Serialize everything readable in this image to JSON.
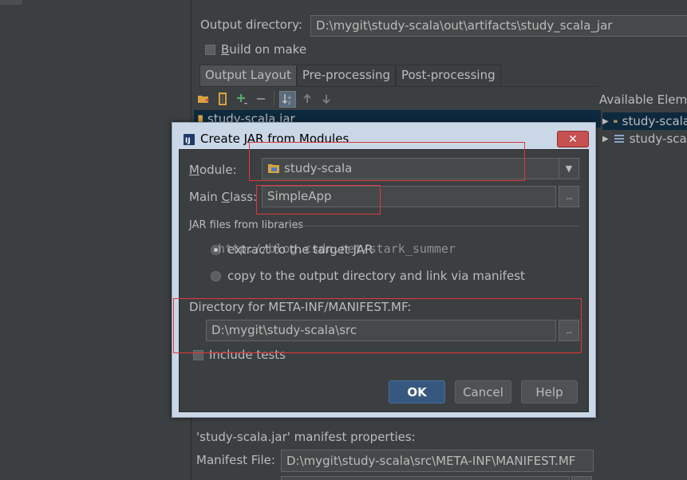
{
  "artifact_settings": {
    "output_directory_label": "Output directory:",
    "output_directory_value": "D:\\mygit\\study-scala\\out\\artifacts\\study_scala_jar",
    "build_on_make_label": "Build on make",
    "tabs": [
      {
        "label": "Output Layout",
        "active": true
      },
      {
        "label": "Pre-processing",
        "active": false
      },
      {
        "label": "Post-processing",
        "active": false
      }
    ],
    "layout_root_item": "study-scala.jar",
    "available_elements_header": "Available Elements",
    "available_elements": [
      "study-scala",
      "study-scala"
    ],
    "manifest_heading": "'study-scala.jar' manifest properties:",
    "manifest_file_label": "Manifest File:",
    "manifest_file_value": "D:\\mygit\\study-scala\\src\\META-INF\\MANIFEST.MF"
  },
  "dialog": {
    "title": "Create JAR from Modules",
    "close_glyph": "✕",
    "module_label": "Module:",
    "module_value": "study-scala",
    "main_class_label": "Main Class:",
    "main_class_value": "SimpleApp",
    "browse_glyph": "...",
    "jar_files_section_label": "JAR files from libraries",
    "radio_extract_label": "extract to the target JAR",
    "radio_copy_label": "copy to the output directory and link via manifest",
    "selected_radio": "extract",
    "manifest_dir_label": "Directory for META-INF/MANIFEST.MF:",
    "manifest_dir_value": "D:\\mygit\\study-scala\\src",
    "include_tests_label": "Include tests",
    "include_tests_checked": false,
    "ok_label": "OK",
    "cancel_label": "Cancel",
    "help_label": "Help"
  },
  "watermark_text": "http://blog.csdn.net/stark_summer",
  "colors": {
    "ide_background": "#3c3f41",
    "field_background": "#45494a",
    "dialog_frame": "#cad7e6",
    "selection": "#0d293e",
    "ok_button": "#365880",
    "annotation_red": "#e0383b",
    "close_button": "#c75050"
  },
  "icons": {
    "toolbar": [
      "new-folder-icon",
      "archive-icon",
      "add-icon",
      "remove-icon",
      "sort-icon",
      "move-up-icon",
      "move-down-icon"
    ],
    "dialog_title": "intellij-icon",
    "module": "module-folder-icon"
  }
}
